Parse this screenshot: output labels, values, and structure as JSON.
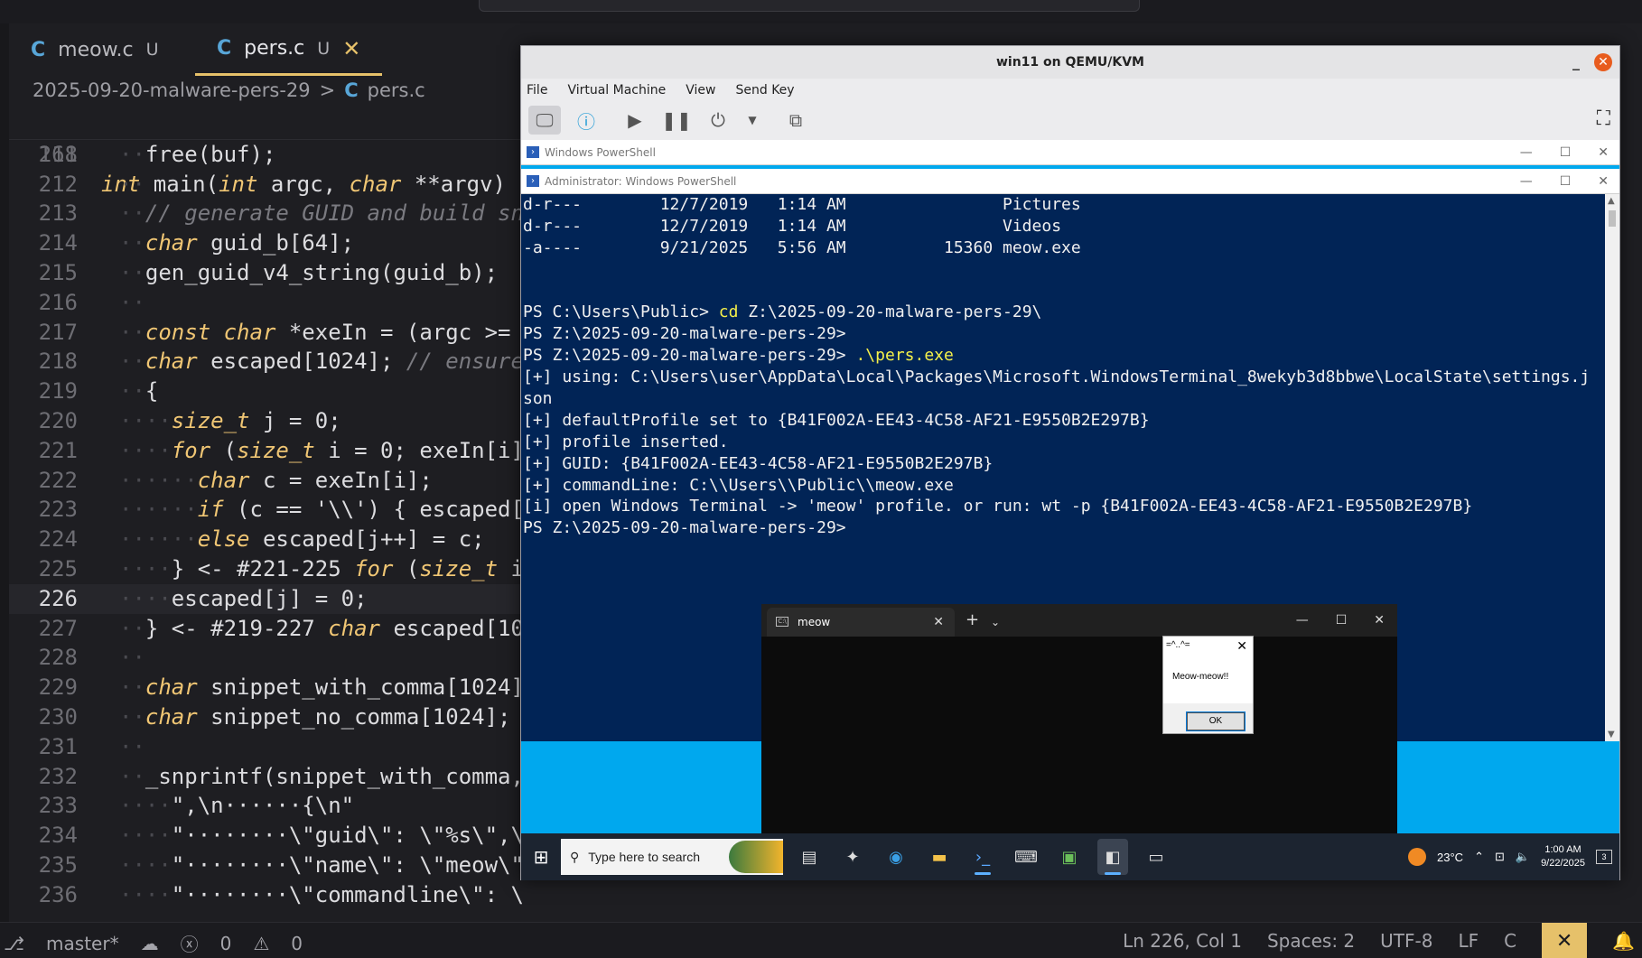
{
  "editor": {
    "tabs": [
      {
        "lang_icon": "C",
        "label": "meow.c",
        "status": "U"
      },
      {
        "lang_icon": "C",
        "label": "pers.c",
        "status": "U",
        "close": "✕"
      }
    ],
    "breadcrumb": {
      "folder": "2025-09-20-malware-pers-29",
      "sep": ">",
      "lang_icon": "C",
      "file": "pers.c"
    },
    "sticky": {
      "num": "168",
      "text": "int main(int argc, char **argv)"
    },
    "lines": [
      {
        "num": "211",
        "text": "··free(buf);"
      },
      {
        "num": "212",
        "text": "··"
      },
      {
        "num": "213",
        "text": "··// generate GUID and build sn"
      },
      {
        "num": "214",
        "text": "··char guid_b[64];"
      },
      {
        "num": "215",
        "text": "··gen_guid_v4_string(guid_b);"
      },
      {
        "num": "216",
        "text": "··"
      },
      {
        "num": "217",
        "text": "··const char *exeIn = (argc >= "
      },
      {
        "num": "218",
        "text": "··char escaped[1024]; // ensure"
      },
      {
        "num": "219",
        "text": "··{"
      },
      {
        "num": "220",
        "text": "····size_t j = 0;"
      },
      {
        "num": "221",
        "text": "····for (size_t i = 0; exeIn[i]"
      },
      {
        "num": "222",
        "text": "······char c = exeIn[i];"
      },
      {
        "num": "223",
        "text": "······if (c == '\\\\') { escaped["
      },
      {
        "num": "224",
        "text": "······else escaped[j++] = c;"
      },
      {
        "num": "225",
        "text": "····} <- #221-225 for (size_t i"
      },
      {
        "num": "226",
        "text": "····escaped[j] = 0;"
      },
      {
        "num": "227",
        "text": "··} <- #219-227 char escaped[10"
      },
      {
        "num": "228",
        "text": "··"
      },
      {
        "num": "229",
        "text": "··char snippet_with_comma[1024]"
      },
      {
        "num": "230",
        "text": "··char snippet_no_comma[1024];"
      },
      {
        "num": "231",
        "text": "··"
      },
      {
        "num": "232",
        "text": "··_snprintf(snippet_with_comma,"
      },
      {
        "num": "233",
        "text": "····\",\\n······{\\n\""
      },
      {
        "num": "234",
        "text": "····\"········\\\"guid\\\": \\\"%s\\\",\\"
      },
      {
        "num": "235",
        "text": "····\"········\\\"name\\\": \\\"meow\\\""
      },
      {
        "num": "236",
        "text": "····\"········\\\"commandline\\\": \\"
      }
    ],
    "current_line": "226"
  },
  "statusbar": {
    "branch": "master*",
    "errors": "0",
    "warnings": "0",
    "position": "Ln 226, Col 1",
    "spaces": "Spaces: 2",
    "encoding": "UTF-8",
    "eol": "LF",
    "language": "C"
  },
  "vm": {
    "title": "win11 on QEMU/KVM",
    "menu": [
      "File",
      "Virtual Machine",
      "View",
      "Send Key"
    ],
    "guest": {
      "ps_bg_title": "Windows PowerShell",
      "ps_title": "Administrator: Windows PowerShell",
      "console": [
        {
          "text": "d-r---        12/7/2019   1:14 AM                Pictures"
        },
        {
          "text": "d-r---        12/7/2019   1:14 AM                Videos"
        },
        {
          "text": "-a----        9/21/2025   5:56 AM          15360 meow.exe"
        },
        {
          "text": ""
        },
        {
          "text": ""
        },
        {
          "text": "PS C:\\Users\\Public> ",
          "hl": "cd",
          "rest": " Z:\\2025-09-20-malware-pers-29\\"
        },
        {
          "text": "PS Z:\\2025-09-20-malware-pers-29>"
        },
        {
          "text": "PS Z:\\2025-09-20-malware-pers-29> ",
          "hl": ".\\pers.exe",
          "rest": ""
        },
        {
          "text": "[+] using: C:\\Users\\user\\AppData\\Local\\Packages\\Microsoft.WindowsTerminal_8wekyb3d8bbwe\\LocalState\\settings.j"
        },
        {
          "text": "son"
        },
        {
          "text": "[+] defaultProfile set to {B41F002A-EE43-4C58-AF21-E9550B2E297B}"
        },
        {
          "text": "[+] profile inserted."
        },
        {
          "text": "[+] GUID: {B41F002A-EE43-4C58-AF21-E9550B2E297B}"
        },
        {
          "text": "[+] commandLine: C:\\\\Users\\\\Public\\\\meow.exe"
        },
        {
          "text": "[i] open Windows Terminal -> 'meow' profile. or run: wt -p {B41F002A-EE43-4C58-AF21-E9550B2E297B}"
        },
        {
          "text": "PS Z:\\2025-09-20-malware-pers-29>"
        }
      ],
      "terminal_tab": "meow",
      "msgbox": {
        "title": "=^..^=",
        "message": "Meow-meow!!",
        "ok": "OK"
      },
      "taskbar": {
        "search_placeholder": "Type here to search",
        "weather": "23°C",
        "time": "1:00 AM",
        "date": "9/22/2025",
        "notif_count": "3"
      }
    }
  },
  "colors": {
    "accent": "#e6c16a",
    "ps_bg": "#012456",
    "desktop": "#00a8ee"
  }
}
